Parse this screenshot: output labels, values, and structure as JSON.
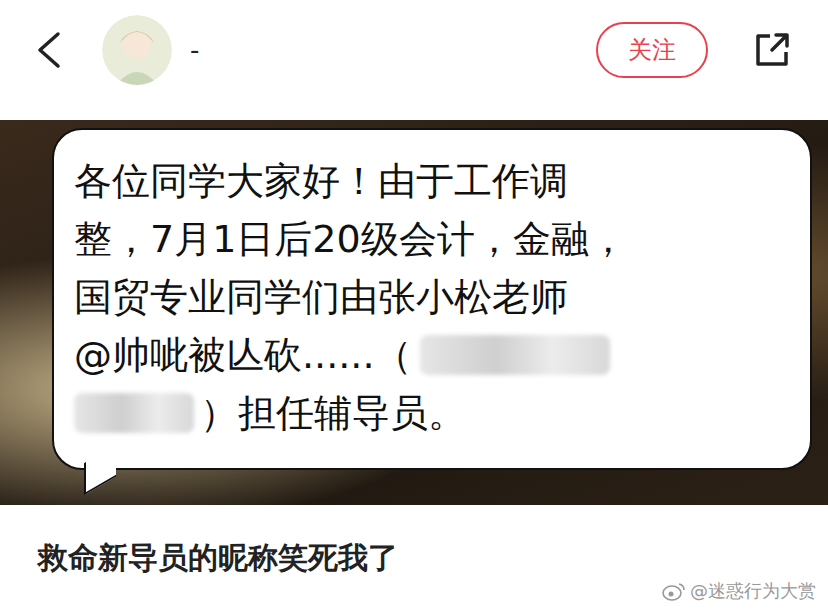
{
  "top_bar": {
    "username": "-",
    "follow_button": "关注"
  },
  "post_image": {
    "bubble": {
      "lines": [
        {
          "parts": [
            {
              "kind": "text",
              "text": "各位同学大家好！由于工作调"
            }
          ]
        },
        {
          "parts": [
            {
              "kind": "text",
              "text": "整，7月1日后20级会计，金融，"
            }
          ]
        },
        {
          "parts": [
            {
              "kind": "text",
              "text": "国贸专业同学们由张小松老师"
            }
          ]
        },
        {
          "parts": [
            {
              "kind": "text",
              "text": "@帅呲被亾砍......（"
            },
            {
              "kind": "blur",
              "text": ""
            }
          ]
        },
        {
          "parts": [
            {
              "kind": "blur",
              "text": ""
            },
            {
              "kind": "text",
              "text": "）担任辅导员。"
            }
          ]
        }
      ]
    }
  },
  "caption": "救命新导员的昵称笑死我了",
  "watermark": "@迷惑行为大赏"
}
